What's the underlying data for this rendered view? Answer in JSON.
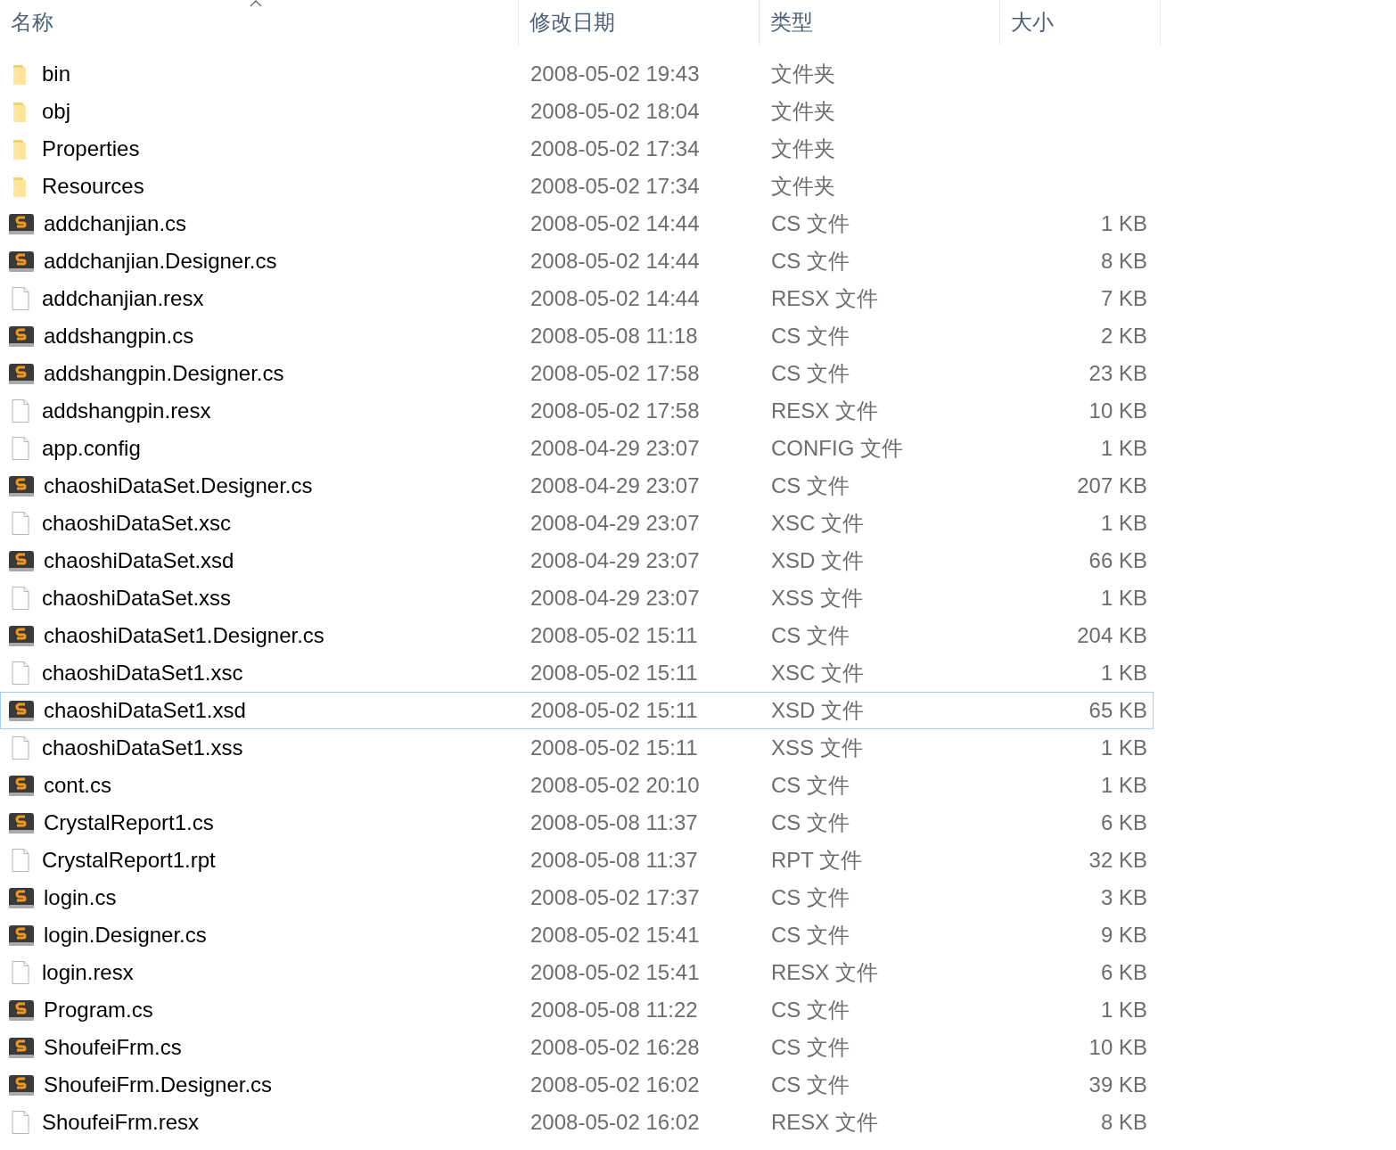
{
  "columns": [
    {
      "label": "名称",
      "sorted": true
    },
    {
      "label": "修改日期",
      "sorted": false
    },
    {
      "label": "类型",
      "sorted": false
    },
    {
      "label": "大小",
      "sorted": false
    }
  ],
  "rows": [
    {
      "kind": "folder",
      "name": "bin",
      "date": "2008-05-02 19:43",
      "type": "文件夹",
      "focused": false
    },
    {
      "kind": "folder",
      "name": "obj",
      "date": "2008-05-02 18:04",
      "type": "文件夹",
      "focused": false
    },
    {
      "kind": "folder",
      "name": "Properties",
      "date": "2008-05-02 17:34",
      "type": "文件夹",
      "focused": false
    },
    {
      "kind": "folder",
      "name": "Resources",
      "date": "2008-05-02 17:34",
      "type": "文件夹",
      "focused": false
    },
    {
      "kind": "source",
      "name": "addchanjian.cs",
      "date": "2008-05-02 14:44",
      "type": "CS 文件",
      "size": "1 KB",
      "focused": false
    },
    {
      "kind": "source",
      "name": "addchanjian.Designer.cs",
      "date": "2008-05-02 14:44",
      "type": "CS 文件",
      "size": "8 KB",
      "focused": false
    },
    {
      "kind": "file",
      "name": "addchanjian.resx",
      "date": "2008-05-02 14:44",
      "type": "RESX 文件",
      "size": "7 KB",
      "focused": false
    },
    {
      "kind": "source",
      "name": "addshangpin.cs",
      "date": "2008-05-08 11:18",
      "type": "CS 文件",
      "size": "2 KB",
      "focused": false
    },
    {
      "kind": "source",
      "name": "addshangpin.Designer.cs",
      "date": "2008-05-02 17:58",
      "type": "CS 文件",
      "size": "23 KB",
      "focused": false
    },
    {
      "kind": "file",
      "name": "addshangpin.resx",
      "date": "2008-05-02 17:58",
      "type": "RESX 文件",
      "size": "10 KB",
      "focused": false
    },
    {
      "kind": "file",
      "name": "app.config",
      "date": "2008-04-29 23:07",
      "type": "CONFIG 文件",
      "size": "1 KB",
      "focused": false
    },
    {
      "kind": "source",
      "name": "chaoshiDataSet.Designer.cs",
      "date": "2008-04-29 23:07",
      "type": "CS 文件",
      "size": "207 KB",
      "focused": false
    },
    {
      "kind": "file",
      "name": "chaoshiDataSet.xsc",
      "date": "2008-04-29 23:07",
      "type": "XSC 文件",
      "size": "1 KB",
      "focused": false
    },
    {
      "kind": "source",
      "name": "chaoshiDataSet.xsd",
      "date": "2008-04-29 23:07",
      "type": "XSD 文件",
      "size": "66 KB",
      "focused": false
    },
    {
      "kind": "file",
      "name": "chaoshiDataSet.xss",
      "date": "2008-04-29 23:07",
      "type": "XSS 文件",
      "size": "1 KB",
      "focused": false
    },
    {
      "kind": "source",
      "name": "chaoshiDataSet1.Designer.cs",
      "date": "2008-05-02 15:11",
      "type": "CS 文件",
      "size": "204 KB",
      "focused": false
    },
    {
      "kind": "file",
      "name": "chaoshiDataSet1.xsc",
      "date": "2008-05-02 15:11",
      "type": "XSC 文件",
      "size": "1 KB",
      "focused": false
    },
    {
      "kind": "source",
      "name": "chaoshiDataSet1.xsd",
      "date": "2008-05-02 15:11",
      "type": "XSD 文件",
      "size": "65 KB",
      "focused": true
    },
    {
      "kind": "file",
      "name": "chaoshiDataSet1.xss",
      "date": "2008-05-02 15:11",
      "type": "XSS 文件",
      "size": "1 KB",
      "focused": false
    },
    {
      "kind": "source",
      "name": "cont.cs",
      "date": "2008-05-02 20:10",
      "type": "CS 文件",
      "size": "1 KB",
      "focused": false
    },
    {
      "kind": "source",
      "name": "CrystalReport1.cs",
      "date": "2008-05-08 11:37",
      "type": "CS 文件",
      "size": "6 KB",
      "focused": false
    },
    {
      "kind": "file",
      "name": "CrystalReport1.rpt",
      "date": "2008-05-08 11:37",
      "type": "RPT 文件",
      "size": "32 KB",
      "focused": false
    },
    {
      "kind": "source",
      "name": "login.cs",
      "date": "2008-05-02 17:37",
      "type": "CS 文件",
      "size": "3 KB",
      "focused": false
    },
    {
      "kind": "source",
      "name": "login.Designer.cs",
      "date": "2008-05-02 15:41",
      "type": "CS 文件",
      "size": "9 KB",
      "focused": false
    },
    {
      "kind": "file",
      "name": "login.resx",
      "date": "2008-05-02 15:41",
      "type": "RESX 文件",
      "size": "6 KB",
      "focused": false
    },
    {
      "kind": "source",
      "name": "Program.cs",
      "date": "2008-05-08 11:22",
      "type": "CS 文件",
      "size": "1 KB",
      "focused": false
    },
    {
      "kind": "source",
      "name": "ShoufeiFrm.cs",
      "date": "2008-05-02 16:28",
      "type": "CS 文件",
      "size": "10 KB",
      "focused": false
    },
    {
      "kind": "source",
      "name": "ShoufeiFrm.Designer.cs",
      "date": "2008-05-02 16:02",
      "type": "CS 文件",
      "size": "39 KB",
      "focused": false
    },
    {
      "kind": "file",
      "name": "ShoufeiFrm.resx",
      "date": "2008-05-02 16:02",
      "type": "RESX 文件",
      "size": "8 KB",
      "focused": false
    }
  ]
}
